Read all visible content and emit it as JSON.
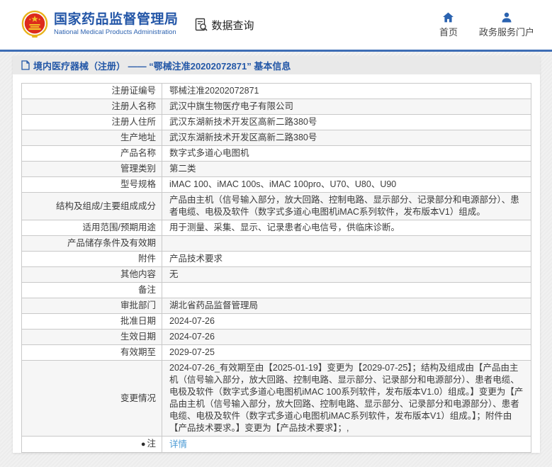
{
  "header": {
    "org_name": "国家药品监督管理局",
    "org_name_en": "National Medical Products Administration",
    "data_query_label": "数据查询",
    "nav": [
      {
        "label": "首页",
        "icon": "home-icon"
      },
      {
        "label": "政务服务门户",
        "icon": "user-icon"
      }
    ]
  },
  "breadcrumb": {
    "text": "境内医疗器械（注册） —— “鄂械注准20202072871” 基本信息"
  },
  "table": {
    "rows": [
      {
        "label": "注册证编号",
        "value": "鄂械注准20202072871"
      },
      {
        "label": "注册人名称",
        "value": "武汉中旗生物医疗电子有限公司"
      },
      {
        "label": "注册人住所",
        "value": "武汉东湖新技术开发区高新二路380号"
      },
      {
        "label": "生产地址",
        "value": "武汉东湖新技术开发区高新二路380号"
      },
      {
        "label": "产品名称",
        "value": "数字式多道心电图机"
      },
      {
        "label": "管理类别",
        "value": "第二类"
      },
      {
        "label": "型号规格",
        "value": "iMAC 100、iMAC 100s、iMAC 100pro、U70、U80、U90"
      },
      {
        "label": "结构及组成/主要组成成分",
        "value": "产品由主机（信号输入部分，放大回路、控制电路、显示部分、记录部分和电源部分）、患者电缆、电极及软件（数字式多道心电图机iMAC系列软件，发布版本V1）组成。"
      },
      {
        "label": "适用范围/预期用途",
        "value": "用于测量、采集、显示、记录患者心电信号，供临床诊断。"
      },
      {
        "label": "产品储存条件及有效期",
        "value": ""
      },
      {
        "label": "附件",
        "value": "产品技术要求"
      },
      {
        "label": "其他内容",
        "value": "无"
      },
      {
        "label": "备注",
        "value": ""
      },
      {
        "label": "审批部门",
        "value": "湖北省药品监督管理局"
      },
      {
        "label": "批准日期",
        "value": "2024-07-26"
      },
      {
        "label": "生效日期",
        "value": "2024-07-26"
      },
      {
        "label": "有效期至",
        "value": "2029-07-25"
      },
      {
        "label": "变更情况",
        "value": "2024-07-26_有效期至由【2025-01-19】变更为【2029-07-25】；结构及组成由【产品由主机（信号输入部分，放大回路、控制电路、显示部分、记录部分和电源部分）、患者电缆、电极及软件（数字式多道心电图机iMAC 100系列软件，发布版本V1.0）组成。】变更为【产品由主机（信号输入部分，放大回路、控制电路、显示部分、记录部分和电源部分）、患者电缆、电极及软件（数字式多道心电图机iMAC系列软件，发布版本V1）组成。】；附件由【产品技术要求。】变更为【产品技术要求】；,"
      },
      {
        "label": "注",
        "dot": true,
        "value": "详情",
        "link": true
      }
    ]
  },
  "colors": {
    "brand_blue": "#2356a7",
    "divider_blue": "#3d6db5",
    "link_blue": "#4a9ad4",
    "emblem_red": "#dd2b1c",
    "emblem_gold": "#f3c22a",
    "row_alt_bg": "#f6f6f6",
    "breadcrumb_bg": "#e9e9e9"
  }
}
